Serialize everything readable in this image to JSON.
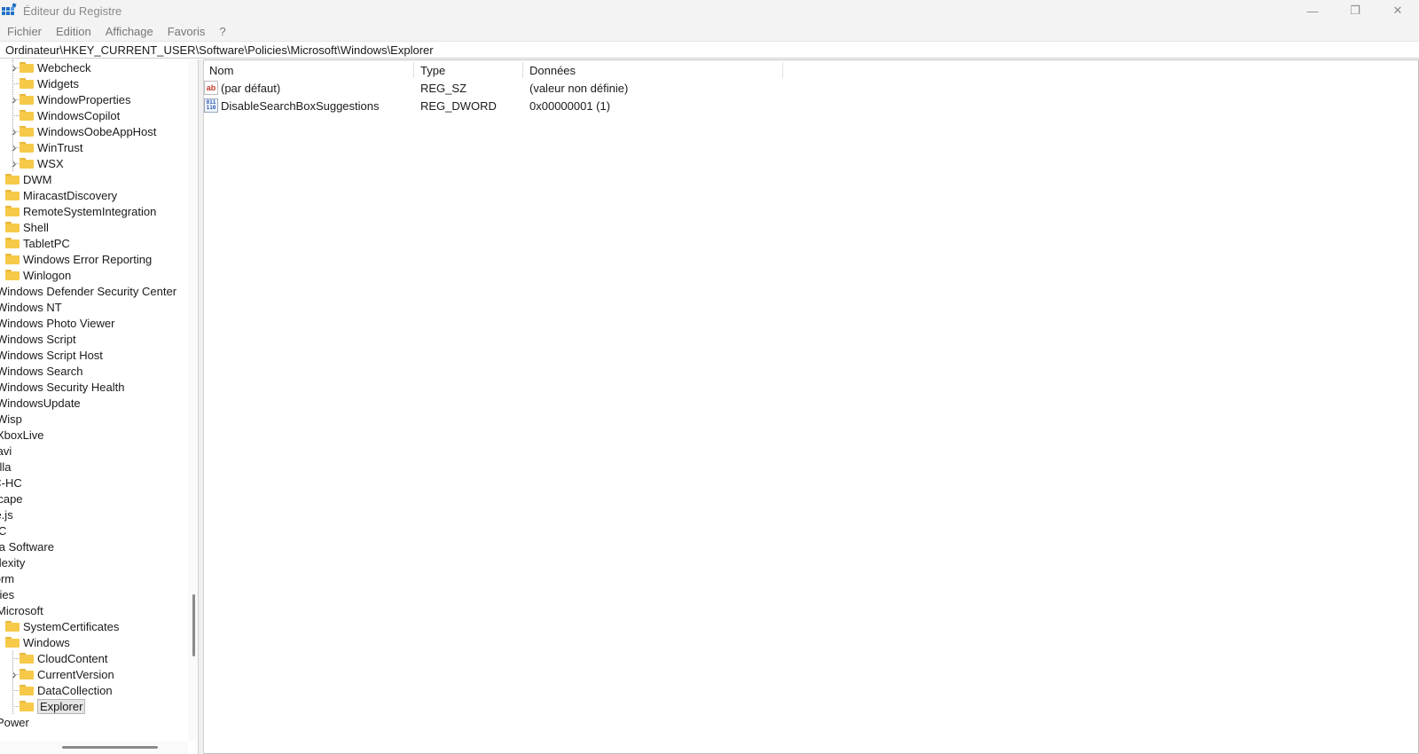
{
  "window": {
    "title": "Éditeur du Registre",
    "controls": {
      "minimize": "—",
      "restore": "❐",
      "close": "✕"
    }
  },
  "menu": [
    "Fichier",
    "Edition",
    "Affichage",
    "Favoris",
    "?"
  ],
  "address": "Ordinateur\\HKEY_CURRENT_USER\\Software\\Policies\\Microsoft\\Windows\\Explorer",
  "tree": [
    {
      "label": "Webcheck",
      "level": 3,
      "expander": true
    },
    {
      "label": "Widgets",
      "level": 3,
      "expander": false
    },
    {
      "label": "WindowProperties",
      "level": 3,
      "expander": true
    },
    {
      "label": "WindowsCopilot",
      "level": 3,
      "expander": false
    },
    {
      "label": "WindowsOobeAppHost",
      "level": 3,
      "expander": true
    },
    {
      "label": "WinTrust",
      "level": 3,
      "expander": true
    },
    {
      "label": "WSX",
      "level": 3,
      "expander": true
    },
    {
      "label": "DWM",
      "level": 2,
      "expander": false
    },
    {
      "label": "MiracastDiscovery",
      "level": 2,
      "expander": false
    },
    {
      "label": "RemoteSystemIntegration",
      "level": 2,
      "expander": false
    },
    {
      "label": "Shell",
      "level": 2,
      "expander": false
    },
    {
      "label": "TabletPC",
      "level": 2,
      "expander": false
    },
    {
      "label": "Windows Error Reporting",
      "level": 2,
      "expander": false
    },
    {
      "label": "Winlogon",
      "level": 2,
      "expander": false
    },
    {
      "label": "Windows Defender Security Center",
      "level": 1,
      "expander": false
    },
    {
      "label": "Windows NT",
      "level": 1,
      "expander": false
    },
    {
      "label": "Windows Photo Viewer",
      "level": 1,
      "expander": false
    },
    {
      "label": "Windows Script",
      "level": 1,
      "expander": false
    },
    {
      "label": "Windows Script Host",
      "level": 1,
      "expander": false
    },
    {
      "label": "Windows Search",
      "level": 1,
      "expander": false
    },
    {
      "label": "Windows Security Health",
      "level": 1,
      "expander": false
    },
    {
      "label": "WindowsUpdate",
      "level": 1,
      "expander": false
    },
    {
      "label": "Wisp",
      "level": 1,
      "expander": false
    },
    {
      "label": "XboxLive",
      "level": 1,
      "expander": false
    },
    {
      "label": "lovavi",
      "level": 0,
      "expander": false
    },
    {
      "label": "lozilla",
      "level": 0,
      "expander": false
    },
    {
      "label": "IPC-HC",
      "level": 0,
      "expander": false
    },
    {
      "label": "etscape",
      "level": 0,
      "expander": false
    },
    {
      "label": "ode.js",
      "level": 0,
      "expander": false
    },
    {
      "label": "DBC",
      "level": 0,
      "expander": false
    },
    {
      "label": "pera Software",
      "level": 0,
      "expander": false
    },
    {
      "label": "erplexity",
      "level": 0,
      "expander": false
    },
    {
      "label": "iriform",
      "level": 0,
      "expander": false
    },
    {
      "label": "olicies",
      "level": 0,
      "expander": false
    },
    {
      "label": "Microsoft",
      "level": 1,
      "expander": false
    },
    {
      "label": "SystemCertificates",
      "level": 2,
      "expander": false
    },
    {
      "label": "Windows",
      "level": 2,
      "expander": false
    },
    {
      "label": "CloudContent",
      "level": 3,
      "expander": false
    },
    {
      "label": "CurrentVersion",
      "level": 3,
      "expander": true
    },
    {
      "label": "DataCollection",
      "level": 3,
      "expander": false
    },
    {
      "label": "Explorer",
      "level": 3,
      "expander": false,
      "selected": true
    },
    {
      "label": "Power",
      "level": 1,
      "expander": false
    }
  ],
  "list": {
    "columns": [
      "Nom",
      "Type",
      "Données"
    ],
    "rows": [
      {
        "icon": "string-value-icon",
        "icon_text": "ab",
        "name": "(par défaut)",
        "type": "REG_SZ",
        "data": "(valeur non définie)"
      },
      {
        "icon": "dword-value-icon",
        "icon_text": "011\n110",
        "name": "DisableSearchBoxSuggestions",
        "type": "REG_DWORD",
        "data": "0x00000001 (1)"
      }
    ]
  }
}
